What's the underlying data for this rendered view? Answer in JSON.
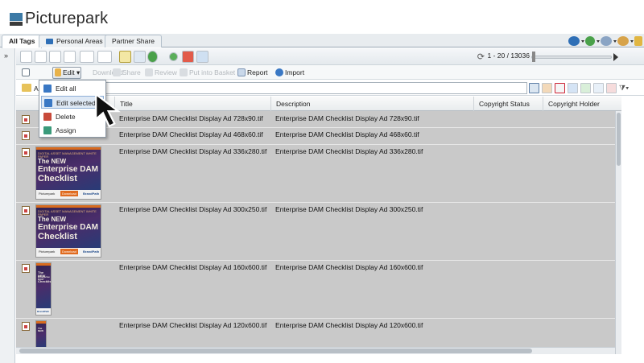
{
  "app": {
    "logo_text": "Picturepark"
  },
  "tabs": [
    {
      "label": "All Tags",
      "active": true
    },
    {
      "label": "Personal Areas",
      "active": false
    },
    {
      "label": "Partner Share",
      "active": false
    }
  ],
  "header_icons": [
    "help-icon",
    "sync-icon",
    "settings-icon",
    "user-icon",
    "key-icon"
  ],
  "toolbar1": {
    "paging": "1 - 20 / 13036",
    "collapse_label": "»"
  },
  "toolbar2": {
    "edit_label": "Edit",
    "download_label": "Download",
    "share_label": "Share",
    "review_label": "Review",
    "put_into_basket_label": "Put into Basket",
    "report_label": "Report",
    "import_label": "Import"
  },
  "filter": {
    "label": "A"
  },
  "edit_menu": {
    "items": [
      {
        "label": "Edit all",
        "icon": "edit-all-icon",
        "color": "#3a78c4"
      },
      {
        "label": "Edit selected",
        "icon": "edit-selected-icon",
        "color": "#3a78c4",
        "hover": true
      },
      {
        "label": "Delete",
        "icon": "delete-icon",
        "color": "#c84a3a"
      },
      {
        "label": "Assign",
        "icon": "assign-icon",
        "color": "#3a9a7a"
      }
    ]
  },
  "table": {
    "columns": [
      "Title",
      "Description",
      "Copyright Status",
      "Copyright Holder"
    ],
    "rows": [
      {
        "title": "Enterprise DAM Checklist Display Ad 728x90.tif",
        "description": "Enterprise DAM Checklist Display Ad 728x90.tif"
      },
      {
        "title": "Enterprise DAM Checklist Display Ad 468x60.tif",
        "description": "Enterprise DAM Checklist Display Ad 468x60.tif"
      },
      {
        "title": "Enterprise DAM Checklist Display Ad 336x280.tif",
        "description": "Enterprise DAM Checklist Display Ad 336x280.tif"
      },
      {
        "title": "Enterprise DAM Checklist Display Ad 300x250.tif",
        "description": "Enterprise DAM Checklist Display Ad 300x250.tif"
      },
      {
        "title": "Enterprise DAM Checklist Display Ad 160x600.tif",
        "description": "Enterprise DAM Checklist Display Ad 160x600.tif"
      },
      {
        "title": "Enterprise DAM Checklist Display Ad 120x600.tif",
        "description": "Enterprise DAM Checklist Display Ad 120x600.tif"
      }
    ]
  },
  "thumbnail_text": {
    "kicker": "DIGITAL ASSET MANAGEMENT WHITE PAPER",
    "line1": "The NEW",
    "line2": "Enterprise DAM",
    "line3": "Checklist",
    "brand_left": "Picturepark",
    "button": "Download",
    "brand_right": "BrandPath"
  },
  "colors": {
    "accent_blue": "#3c7aa6",
    "selected_row": "#c9c9c9",
    "menu_hover": "#dfe9f5"
  }
}
